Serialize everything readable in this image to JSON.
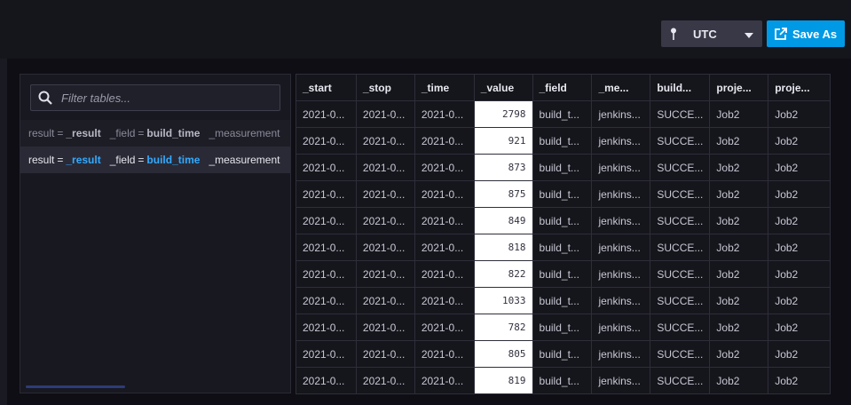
{
  "toolbar": {
    "timezone": "UTC",
    "save_as_label": "Save As"
  },
  "sidebar": {
    "filter_placeholder": "Filter tables...",
    "tables": [
      {
        "result_key": "result",
        "result_val": "_result",
        "field_key": "_field",
        "field_val": "build_time",
        "measurement_key": "_measurement"
      },
      {
        "result_key": "result",
        "result_val": "_result",
        "field_key": "_field",
        "field_val": "build_time",
        "measurement_key": "_measurement"
      }
    ]
  },
  "grid": {
    "columns": [
      "_start",
      "_stop",
      "_time",
      "_value",
      "_field",
      "_me...",
      "build...",
      "proje...",
      "proje..."
    ],
    "rows": [
      [
        "2021-0...",
        "2021-0...",
        "2021-0...",
        "2798",
        "build_t...",
        "jenkins...",
        "SUCCE...",
        "Job2",
        "Job2"
      ],
      [
        "2021-0...",
        "2021-0...",
        "2021-0...",
        "921",
        "build_t...",
        "jenkins...",
        "SUCCE...",
        "Job2",
        "Job2"
      ],
      [
        "2021-0...",
        "2021-0...",
        "2021-0...",
        "873",
        "build_t...",
        "jenkins...",
        "SUCCE...",
        "Job2",
        "Job2"
      ],
      [
        "2021-0...",
        "2021-0...",
        "2021-0...",
        "875",
        "build_t...",
        "jenkins...",
        "SUCCE...",
        "Job2",
        "Job2"
      ],
      [
        "2021-0...",
        "2021-0...",
        "2021-0...",
        "849",
        "build_t...",
        "jenkins...",
        "SUCCE...",
        "Job2",
        "Job2"
      ],
      [
        "2021-0...",
        "2021-0...",
        "2021-0...",
        "818",
        "build_t...",
        "jenkins...",
        "SUCCE...",
        "Job2",
        "Job2"
      ],
      [
        "2021-0...",
        "2021-0...",
        "2021-0...",
        "822",
        "build_t...",
        "jenkins...",
        "SUCCE...",
        "Job2",
        "Job2"
      ],
      [
        "2021-0...",
        "2021-0...",
        "2021-0...",
        "1033",
        "build_t...",
        "jenkins...",
        "SUCCE...",
        "Job2",
        "Job2"
      ],
      [
        "2021-0...",
        "2021-0...",
        "2021-0...",
        "782",
        "build_t...",
        "jenkins...",
        "SUCCE...",
        "Job2",
        "Job2"
      ],
      [
        "2021-0...",
        "2021-0...",
        "2021-0...",
        "805",
        "build_t...",
        "jenkins...",
        "SUCCE...",
        "Job2",
        "Job2"
      ],
      [
        "2021-0...",
        "2021-0...",
        "2021-0...",
        "819",
        "build_t...",
        "jenkins...",
        "SUCCE...",
        "Job2",
        "Job2"
      ]
    ]
  },
  "icons": {
    "timezone": "pin-icon",
    "dropdown": "caret-down-icon",
    "save": "export-icon",
    "filter": "search-icon"
  },
  "colors": {
    "accent": "#0099e6",
    "highlight": "#33aaff"
  }
}
